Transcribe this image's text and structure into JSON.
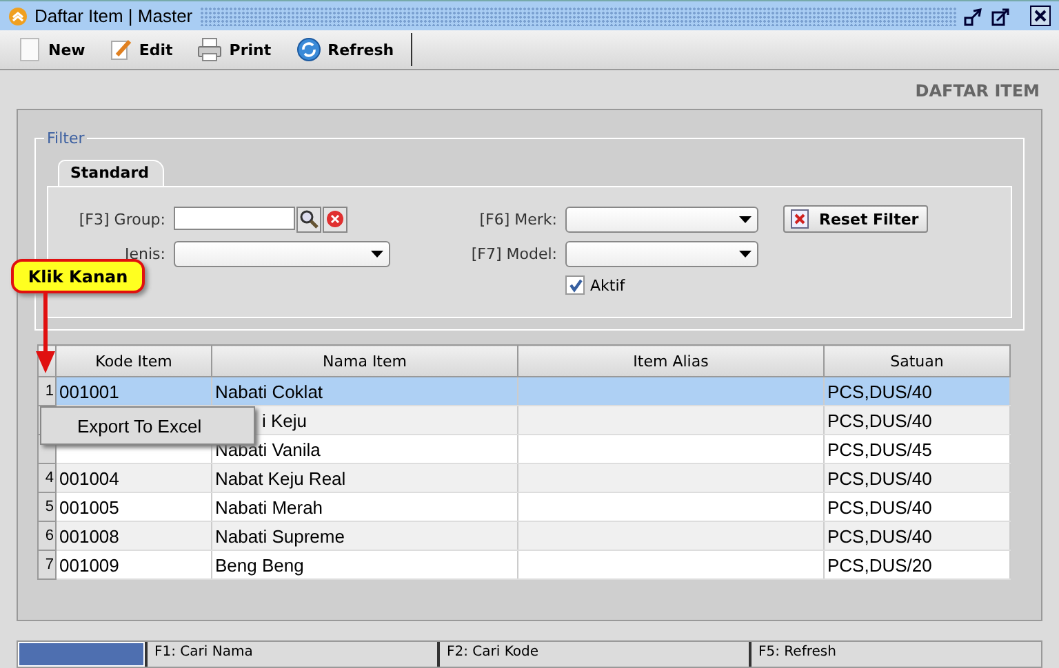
{
  "window": {
    "title": "Daftar Item | Master"
  },
  "toolbar": [
    {
      "label": "New",
      "kind": "new"
    },
    {
      "label": "Edit",
      "kind": "edit"
    },
    {
      "label": "Print",
      "kind": "print"
    },
    {
      "label": "Refresh",
      "kind": "refresh"
    }
  ],
  "heading": "DAFTAR ITEM",
  "filter": {
    "title": "Filter",
    "tabs": [
      {
        "label": "Standard",
        "selected": true
      }
    ],
    "group_label": "[F3] Group:",
    "jenis_label": "Jenis:",
    "merk_label": "[F6] Merk:",
    "model_label": "[F7] Model:",
    "aktif": {
      "label": "Aktif",
      "checked": true
    },
    "reset_button": "Reset Filter"
  },
  "callout": "Klik Kanan",
  "table": {
    "columns": [
      "Kode Item",
      "Nama Item",
      "Item Alias",
      "Satuan"
    ],
    "rows": [
      {
        "num": "1",
        "kode": "001001",
        "nama": "Nabati Coklat",
        "satuan": "PCS,DUS/40",
        "selected": true,
        "covered": false
      },
      {
        "nama": "i Keju",
        "satuan": "PCS,DUS/40",
        "selected": false,
        "covered": true
      },
      {
        "nama": "Nabati Vanila",
        "satuan": "PCS,DUS/45",
        "selected": false,
        "covered": false
      },
      {
        "num": "4",
        "kode": "001004",
        "nama": "Nabat Keju Real",
        "satuan": "PCS,DUS/40",
        "selected": false,
        "covered": false
      },
      {
        "num": "5",
        "kode": "001005",
        "nama": "Nabati Merah",
        "satuan": "PCS,DUS/40",
        "selected": false,
        "covered": false
      },
      {
        "num": "6",
        "kode": "001008",
        "nama": "Nabati Supreme",
        "satuan": "PCS,DUS/40",
        "selected": false,
        "covered": false
      },
      {
        "num": "7",
        "kode": "001009",
        "nama": "Beng Beng",
        "satuan": "PCS,DUS/20",
        "selected": false,
        "covered": false
      }
    ]
  },
  "context_menu": [
    "Export To Excel"
  ],
  "status_bar": [
    "F1: Cari Nama",
    "F2: Cari Kode",
    "F5: Refresh"
  ]
}
